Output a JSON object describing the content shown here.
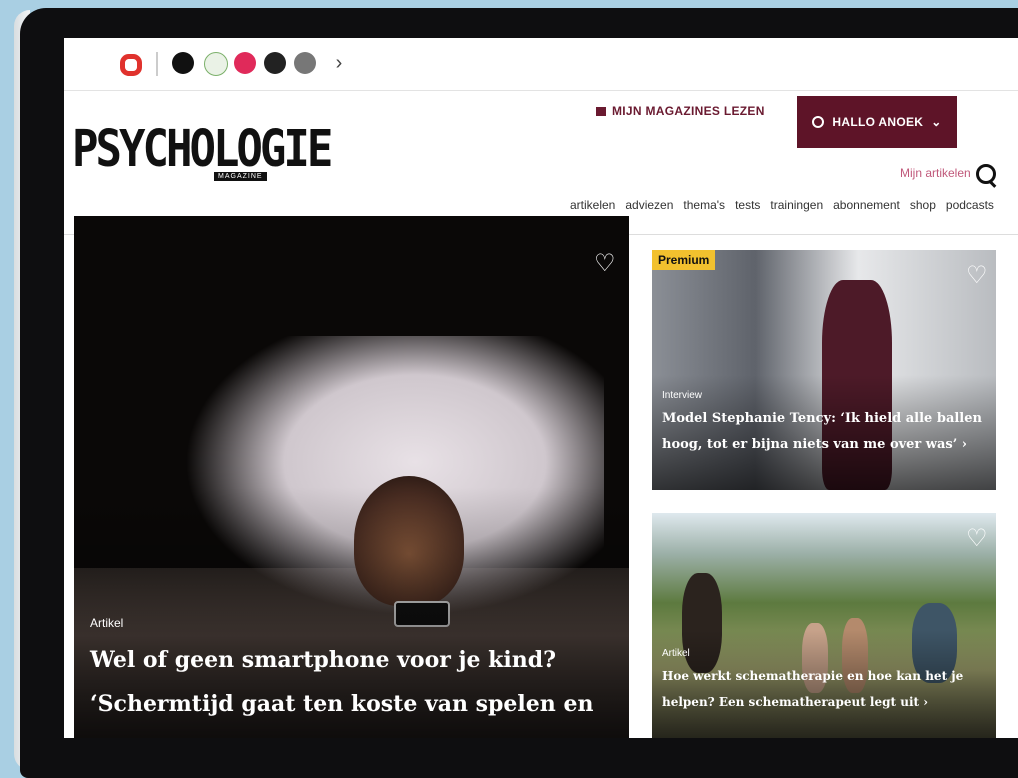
{
  "brandbar": {
    "icons": [
      "psychologie-logo-icon",
      "h-magazine-icon",
      "flower-icon",
      "plus-magazine-icon",
      "dark-magazine-icon",
      "grey-magazine-icon"
    ],
    "more": "›"
  },
  "header": {
    "magazines_link": "MIJN MAGAZINES LEZEN",
    "user_button": "HALLO ANOEK",
    "user_chevron": "⌄",
    "logo": "PSYCHOLOGIE",
    "logo_sub": "MAGAZINE",
    "my_articles": "Mijn artikelen"
  },
  "nav": [
    "artikelen",
    "adviezen",
    "thema's",
    "tests",
    "trainingen",
    "abonnement",
    "shop",
    "podcasts"
  ],
  "cards": [
    {
      "kicker": "Artikel",
      "headline": "Wel of geen smartphone voor je kind? ‘Schermtijd gaat ten koste van spelen en fouten maken’ ›"
    },
    {
      "tag": "Premium",
      "kicker": "Interview",
      "headline": "Model Stephanie Tency: ‘Ik hield alle ballen hoog, tot er bijna niets van me over was’ ›"
    },
    {
      "kicker": "Artikel",
      "headline": "Hoe werkt schematherapie en hoe kan het je helpen? Een schematherapeut legt uit ›"
    }
  ],
  "colors": {
    "brand": "#5e1428",
    "premium": "#f2c12e",
    "link": "#c0587a"
  }
}
